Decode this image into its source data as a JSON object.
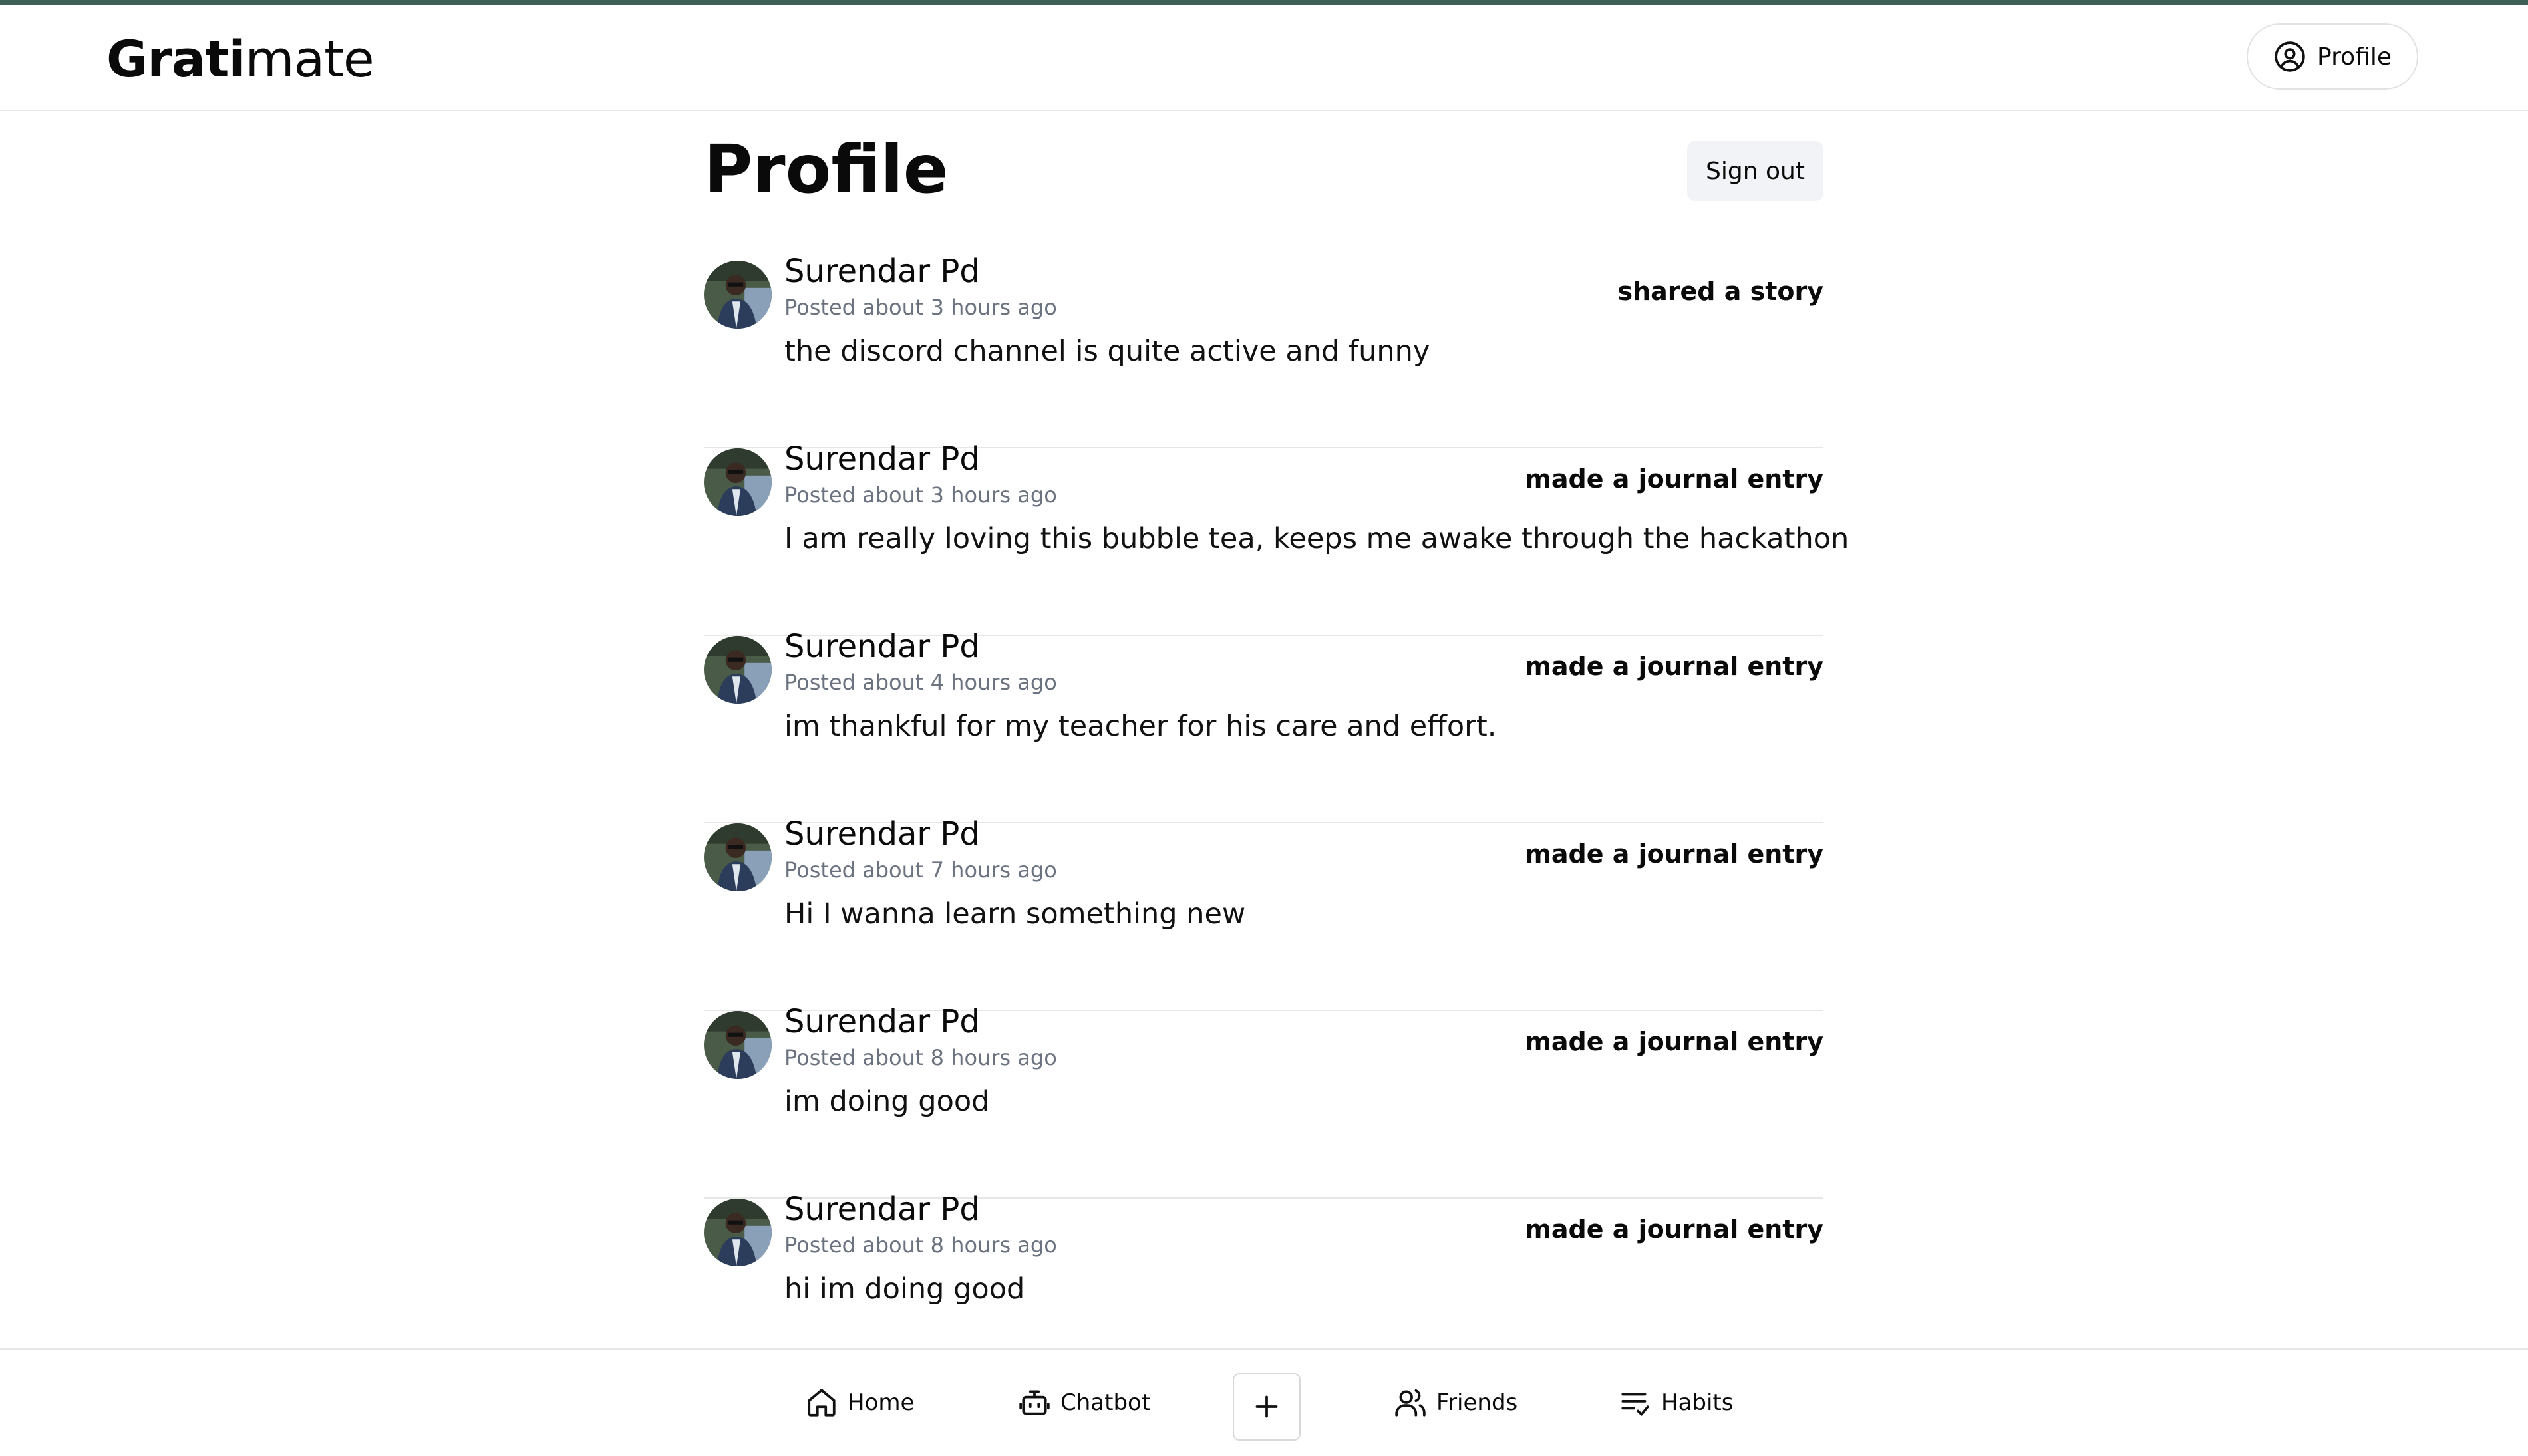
{
  "header": {
    "logo_bold": "Grati",
    "logo_regular": "mate",
    "profile_label": "Profile"
  },
  "main": {
    "title": "Profile",
    "sign_out_label": "Sign out",
    "posts": [
      {
        "author": "Surendar Pd",
        "time": "Posted about 3 hours ago",
        "action": "shared a story",
        "content": "the discord channel is quite active and funny"
      },
      {
        "author": "Surendar Pd",
        "time": "Posted about 3 hours ago",
        "action": "made a journal entry",
        "content": "I am really loving this bubble tea, keeps me awake through the hackathon"
      },
      {
        "author": "Surendar Pd",
        "time": "Posted about 4 hours ago",
        "action": "made a journal entry",
        "content": "im thankful for my teacher for his care and effort."
      },
      {
        "author": "Surendar Pd",
        "time": "Posted about 7 hours ago",
        "action": "made a journal entry",
        "content": "Hi I wanna learn something new"
      },
      {
        "author": "Surendar Pd",
        "time": "Posted about 8 hours ago",
        "action": "made a journal entry",
        "content": "im doing good"
      },
      {
        "author": "Surendar Pd",
        "time": "Posted about 8 hours ago",
        "action": "made a journal entry",
        "content": "hi im doing good"
      }
    ]
  },
  "bottom_nav": {
    "home": "Home",
    "chatbot": "Chatbot",
    "friends": "Friends",
    "habits": "Habits"
  },
  "icons": {
    "profile": "user-circle-icon",
    "home": "home-icon",
    "chatbot": "bot-icon",
    "add": "plus-icon",
    "friends": "users-icon",
    "habits": "list-check-icon"
  },
  "colors": {
    "accent_bar": "#3d5f56",
    "muted_text": "#6b7280",
    "divider": "#e7e7e7",
    "button_bg": "#f1f3f6"
  }
}
